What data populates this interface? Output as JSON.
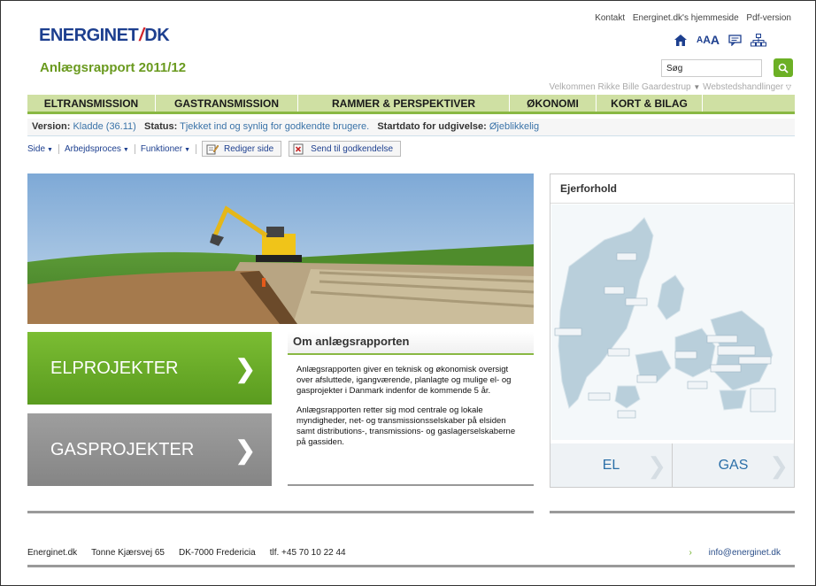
{
  "header": {
    "logo_left": "ENERGINET",
    "logo_right": "DK",
    "report_title": "Anlægsrapport 2011/12",
    "top_links": [
      "Kontakt",
      "Energinet.dk's hjemmeside",
      "Pdf-version"
    ],
    "text_size_label": "AAA",
    "search_value": "Søg",
    "welcome": "Velkommen Rikke Bille Gaardestrup",
    "site_actions": "Webstedshandlinger"
  },
  "nav": [
    {
      "label": "ELTRANSMISSION"
    },
    {
      "label": "GASTRANSMISSION"
    },
    {
      "label": "RAMMER & PERSPEKTIVER"
    },
    {
      "label": "ØKONOMI"
    },
    {
      "label": "KORT & BILAG"
    }
  ],
  "status": {
    "version_label": "Version:",
    "version_value": "Kladde (36.11)",
    "status_label": "Status:",
    "status_value": "Tjekket ind og synlig for godkendte brugere.",
    "start_label": "Startdato for udgivelse:",
    "start_value": "Øjeblikkelig"
  },
  "ribbon": {
    "menus": [
      "Side",
      "Arbejdsproces",
      "Funktioner"
    ],
    "edit_button": "Rediger side",
    "approve_button": "Send til godkendelse"
  },
  "projects": {
    "el": "ELPROJEKTER",
    "gas": "GASPROJEKTER"
  },
  "about": {
    "title": "Om anlægsrapporten",
    "p1": "Anlægsrapporten giver en teknisk og økonomisk oversigt over afsluttede, igangværende, planlagte og mulige el- og gasprojekter i Danmark indenfor de kommende 5 år.",
    "p2": "Anlægsrapporten retter sig mod centrale og lokale myndigheder, net- og transmissionsselskaber på elsiden samt distributions-, transmissions- og gaslagerselskaberne på gassiden."
  },
  "ownership": {
    "title": "Ejerforhold",
    "tab_el": "EL",
    "tab_gas": "GAS"
  },
  "footer": {
    "company": "Energinet.dk",
    "street": "Tonne Kjærsvej 65",
    "city": "DK-7000 Fredericia",
    "phone": "tlf. +45 70 10 22 44",
    "email": "info@energinet.dk"
  },
  "colors": {
    "brand_blue": "#1d3f8f",
    "brand_green": "#6cb025",
    "gas_gray": "#8e8e8e"
  }
}
